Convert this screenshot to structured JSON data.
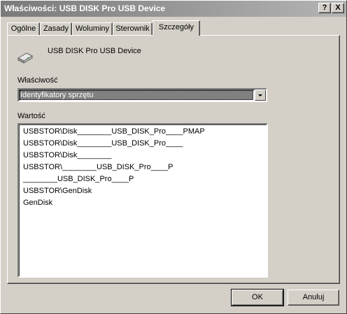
{
  "window": {
    "title": "Właściwości: USB DISK Pro USB Device",
    "help_button": "?",
    "close_button": "X"
  },
  "tabs": [
    {
      "label": "Ogólne"
    },
    {
      "label": "Zasady"
    },
    {
      "label": "Woluminy"
    },
    {
      "label": "Sterownik"
    },
    {
      "label": "Szczegóły"
    }
  ],
  "details": {
    "device_name": "USB DISK Pro USB Device",
    "device_icon": "usb-drive-icon",
    "property_label": "Właściwość",
    "property_selected": "Identyfikatory sprzętu",
    "value_label": "Wartość",
    "values": [
      "USBSTOR\\Disk________USB_DISK_Pro____PMAP",
      "USBSTOR\\Disk________USB_DISK_Pro____",
      "USBSTOR\\Disk________",
      "USBSTOR\\________USB_DISK_Pro____P",
      "________USB_DISK_Pro____P",
      "USBSTOR\\GenDisk",
      "GenDisk"
    ]
  },
  "buttons": {
    "ok": "OK",
    "cancel": "Anuluj"
  }
}
